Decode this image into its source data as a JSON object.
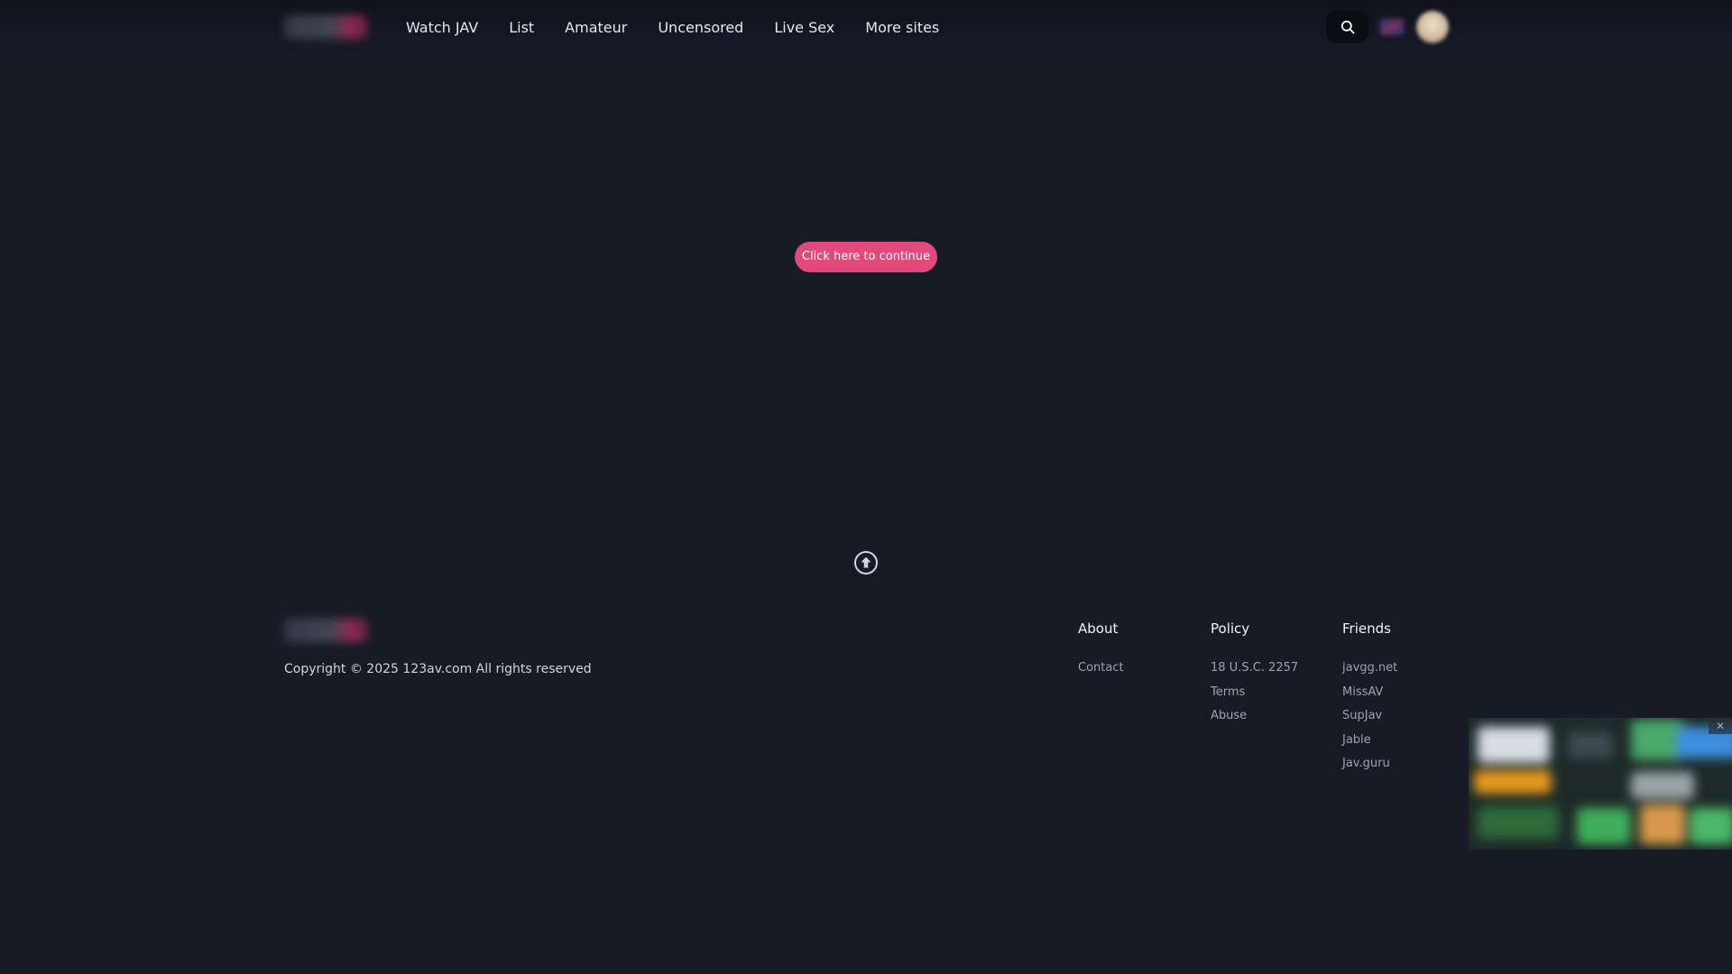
{
  "header": {
    "nav": [
      "Watch JAV",
      "List",
      "Amateur",
      "Uncensored",
      "Live Sex",
      "More sites"
    ]
  },
  "main": {
    "continue_label": "Click here to continue"
  },
  "footer": {
    "copyright": "Copyright © 2025 123av.com All rights reserved",
    "about": {
      "title": "About",
      "links": [
        "Contact"
      ]
    },
    "policy": {
      "title": "Policy",
      "links": [
        "18 U.S.C. 2257",
        "Terms",
        "Abuse"
      ]
    },
    "friends": {
      "title": "Friends",
      "links": [
        "javgg.net",
        "MissAV",
        "SupJav",
        "Jable",
        "Jav.guru"
      ]
    }
  },
  "ad": {
    "close_label": "✕"
  },
  "colors": {
    "background": "#171b26",
    "accent": "#e0497a"
  },
  "icons": {
    "search": "search-icon",
    "scroll_top": "arrow-up-circle-icon",
    "close": "close-icon"
  }
}
